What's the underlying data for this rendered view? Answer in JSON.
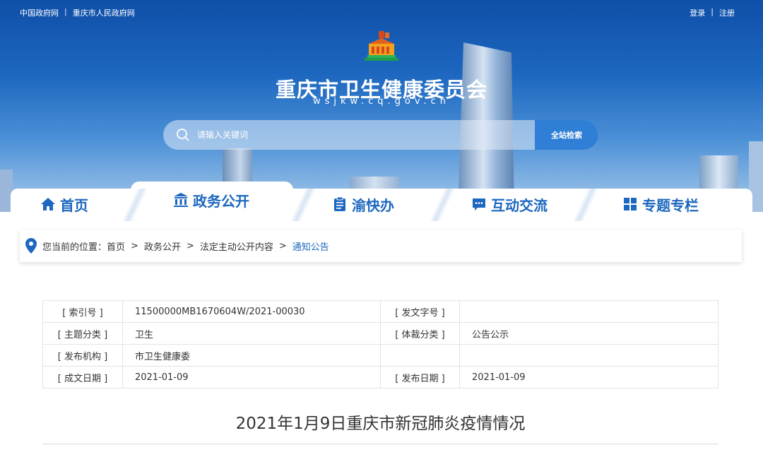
{
  "top_links": {
    "central_gov": "中国政府网",
    "separator": "|",
    "city_gov": "重庆市人民政府网"
  },
  "account": {
    "login": "登录",
    "separator": "|",
    "register": "注册"
  },
  "site": {
    "title": "重庆市卫生健康委员会",
    "domain": "wsjkw.cq.gov.cn"
  },
  "search": {
    "placeholder": "请输入关键词",
    "button_label": "全站检索"
  },
  "nav": {
    "items": [
      {
        "label": "首页",
        "icon": "home-icon"
      },
      {
        "label": "政务公开",
        "icon": "government-building-icon"
      },
      {
        "label": "渝快办",
        "icon": "clipboard-icon"
      },
      {
        "label": "互动交流",
        "icon": "chat-icon"
      },
      {
        "label": "专题专栏",
        "icon": "grid-icon"
      }
    ],
    "active_index": 1
  },
  "breadcrumb": {
    "prefix": "您当前的位置：",
    "items": [
      "首页",
      "政务公开",
      "法定主动公开内容",
      "通知公告"
    ],
    "separator": ">"
  },
  "meta": {
    "rows": [
      {
        "k1": "[ 索引号 ]",
        "v1": "11500000MB1670604W/2021-00030",
        "k2": "[ 发文字号 ]",
        "v2": ""
      },
      {
        "k1": "[ 主题分类 ]",
        "v1": "卫生",
        "k2": "[ 体裁分类 ]",
        "v2": "公告公示"
      },
      {
        "k1": "[ 发布机构 ]",
        "v1": "市卫生健康委",
        "k2": "",
        "v2": ""
      },
      {
        "k1": "[ 成文日期 ]",
        "v1": "2021-01-09",
        "k2": "[ 发布日期 ]",
        "v2": "2021-01-09"
      }
    ]
  },
  "article": {
    "title": "2021年1月9日重庆市新冠肺炎疫情情况"
  },
  "colors": {
    "brand_blue": "#1c67bf",
    "search_button": "#2f7fd6"
  }
}
